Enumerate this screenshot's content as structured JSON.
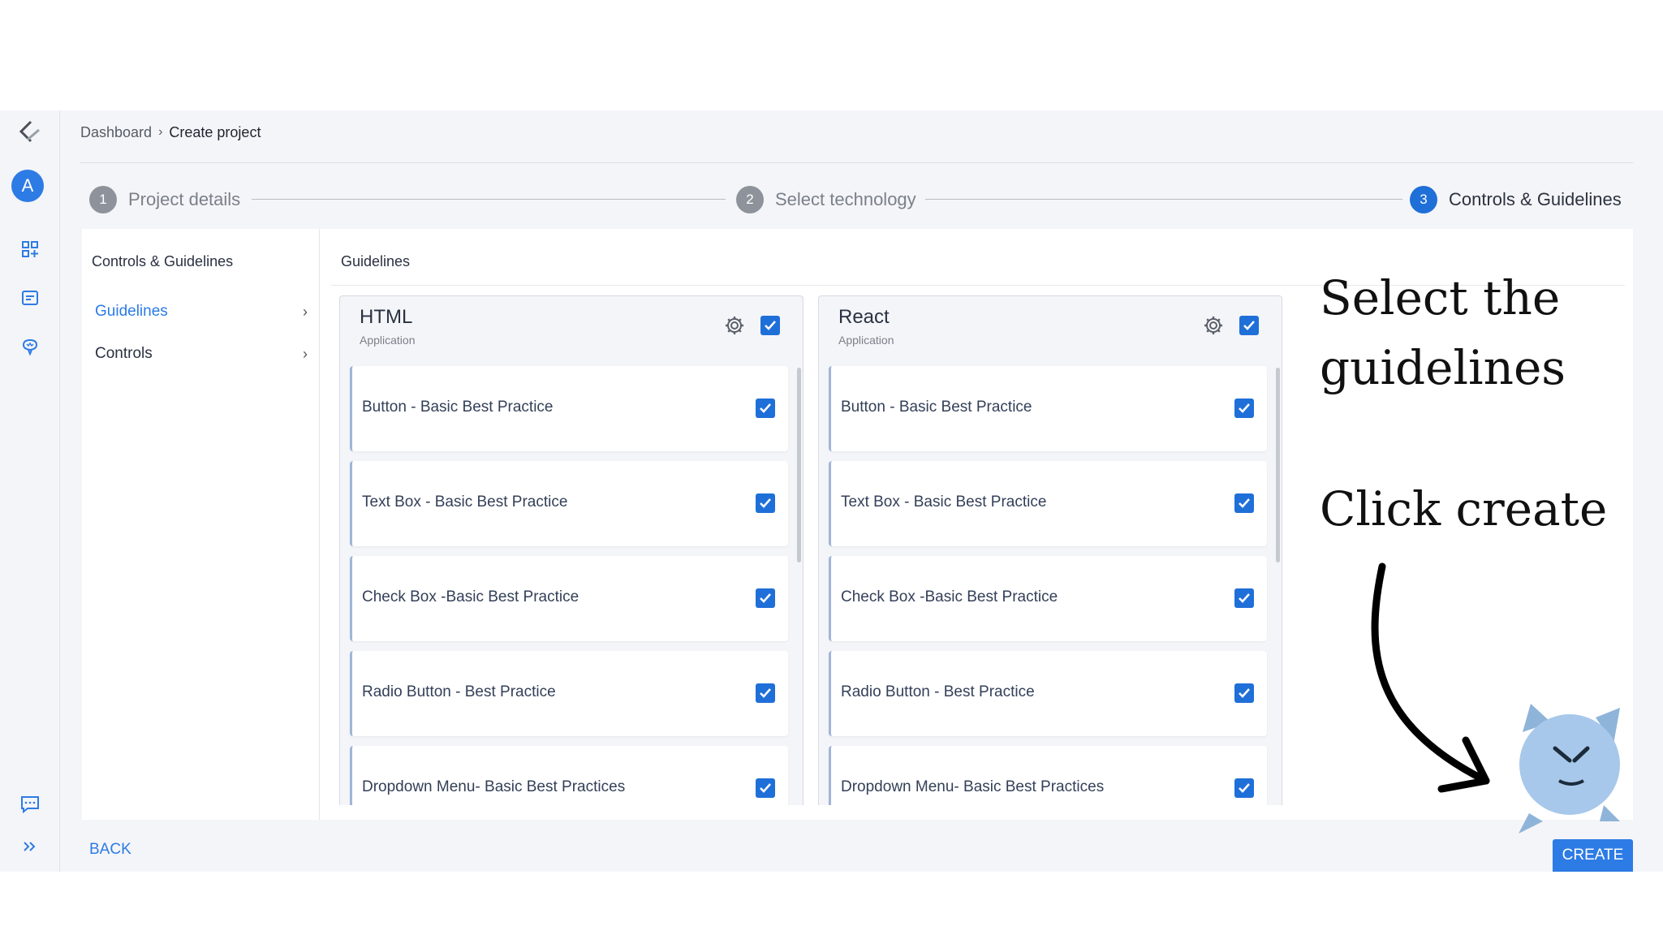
{
  "breadcrumb": {
    "root": "Dashboard",
    "separator": "›",
    "current": "Create project"
  },
  "rail": {
    "avatar_initial": "A",
    "icons": [
      "logo-icon",
      "dashboard-icon",
      "report-icon",
      "brain-icon",
      "chat-icon",
      "expand-icon"
    ]
  },
  "stepper": [
    {
      "num": "1",
      "label": "Project details",
      "active": false
    },
    {
      "num": "2",
      "label": "Select technology",
      "active": false
    },
    {
      "num": "3",
      "label": "Controls & Guidelines",
      "active": true
    }
  ],
  "subnav": {
    "title": "Controls & Guidelines",
    "items": [
      {
        "label": "Guidelines",
        "active": true
      },
      {
        "label": "Controls",
        "active": false
      }
    ]
  },
  "guidelines": {
    "title": "Guidelines",
    "columns": [
      {
        "title": "HTML",
        "subtitle": "Application",
        "checked": true,
        "items": [
          {
            "label": "Button - Basic Best Practice",
            "checked": true
          },
          {
            "label": "Text Box - Basic Best Practice",
            "checked": true
          },
          {
            "label": "Check Box -Basic Best Practice",
            "checked": true
          },
          {
            "label": "Radio Button - Best Practice",
            "checked": true
          },
          {
            "label": "Dropdown Menu- Basic Best Practices",
            "checked": true
          }
        ]
      },
      {
        "title": "React",
        "subtitle": "Application",
        "checked": true,
        "items": [
          {
            "label": "Button - Basic Best Practice",
            "checked": true
          },
          {
            "label": "Text Box - Basic Best Practice",
            "checked": true
          },
          {
            "label": "Check Box -Basic Best Practice",
            "checked": true
          },
          {
            "label": "Radio Button - Best Practice",
            "checked": true
          },
          {
            "label": "Dropdown Menu- Basic Best Practices",
            "checked": true
          }
        ]
      }
    ]
  },
  "actions": {
    "back_label": "BACK",
    "create_label": "CREATE"
  },
  "annotation": {
    "line1": "Select the",
    "line2": "guidelines",
    "line3": "Click create"
  },
  "colors": {
    "accent": "#2d7be5",
    "active_step": "#1f6fd9",
    "inactive_step": "#8e939b"
  }
}
